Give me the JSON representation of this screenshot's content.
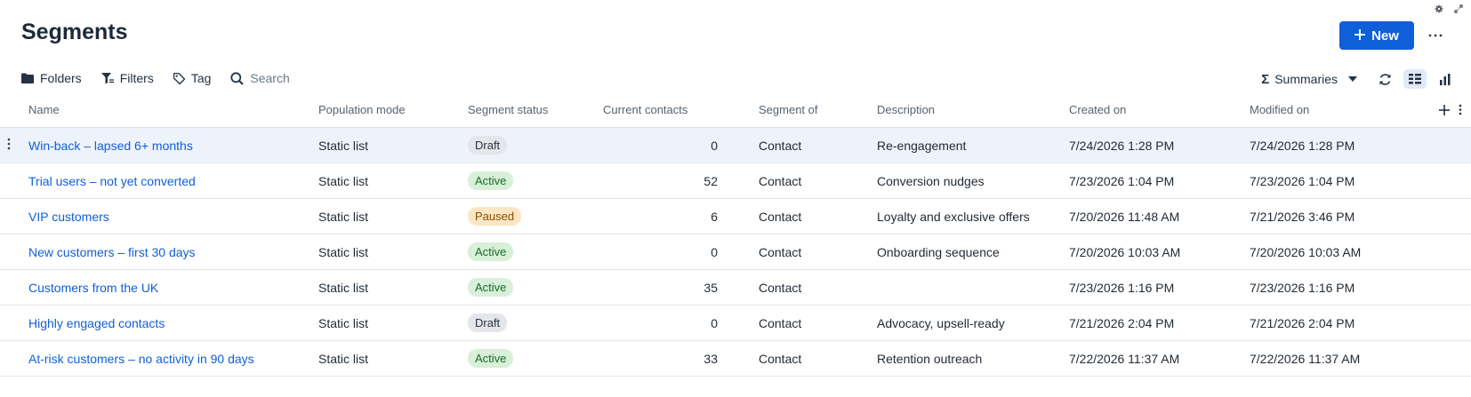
{
  "page": {
    "title": "Segments",
    "new_button_label": "New",
    "more_label": "···"
  },
  "toolbar": {
    "folders_label": "Folders",
    "filters_label": "Filters",
    "tag_label": "Tag",
    "search_placeholder": "Search",
    "summaries_label": "Summaries"
  },
  "table": {
    "headers": {
      "name": "Name",
      "population_mode": "Population mode",
      "segment_status": "Segment status",
      "current_contacts": "Current contacts",
      "segment_of": "Segment of",
      "description": "Description",
      "created_on": "Created on",
      "modified_on": "Modified on"
    },
    "rows": [
      {
        "name": "Win-back – lapsed 6+ months",
        "population_mode": "Static list",
        "status": "Draft",
        "contacts": "0",
        "segment_of": "Contact",
        "description": "Re-engagement",
        "created_on": "7/24/2026 1:28 PM",
        "modified_on": "7/24/2026 1:28 PM"
      },
      {
        "name": "Trial users – not yet converted",
        "population_mode": "Static list",
        "status": "Active",
        "contacts": "52",
        "segment_of": "Contact",
        "description": "Conversion nudges",
        "created_on": "7/23/2026 1:04 PM",
        "modified_on": "7/23/2026 1:04 PM"
      },
      {
        "name": "VIP customers",
        "population_mode": "Static list",
        "status": "Paused",
        "contacts": "6",
        "segment_of": "Contact",
        "description": "Loyalty and exclusive offers",
        "created_on": "7/20/2026 11:48 AM",
        "modified_on": "7/21/2026 3:46 PM"
      },
      {
        "name": "New customers – first 30 days",
        "population_mode": "Static list",
        "status": "Active",
        "contacts": "0",
        "segment_of": "Contact",
        "description": "Onboarding sequence",
        "created_on": "7/20/2026 10:03 AM",
        "modified_on": "7/20/2026 10:03 AM"
      },
      {
        "name": "Customers from the UK",
        "population_mode": "Static list",
        "status": "Active",
        "contacts": "35",
        "segment_of": "Contact",
        "description": "",
        "created_on": "7/23/2026 1:16 PM",
        "modified_on": "7/23/2026 1:16 PM"
      },
      {
        "name": "Highly engaged contacts",
        "population_mode": "Static list",
        "status": "Draft",
        "contacts": "0",
        "segment_of": "Contact",
        "description": "Advocacy, upsell-ready",
        "created_on": "7/21/2026 2:04 PM",
        "modified_on": "7/21/2026 2:04 PM"
      },
      {
        "name": "At-risk customers – no activity in 90 days",
        "population_mode": "Static list",
        "status": "Active",
        "contacts": "33",
        "segment_of": "Contact",
        "description": "Retention outreach",
        "created_on": "7/22/2026 11:37 AM",
        "modified_on": "7/22/2026 11:37 AM"
      }
    ]
  },
  "colors": {
    "accent": "#0f5fd9",
    "draft_badge": "#e4e6e9",
    "active_badge": "#d7f0d7",
    "paused_badge": "#fbe6c3",
    "selected_row": "#eef3fb"
  },
  "icons": {
    "settings": "gear-icon",
    "expand": "expand-icon",
    "new": "plus-icon",
    "folders": "folder-icon",
    "filters": "filter-icon",
    "tag": "tag-icon",
    "search": "search-icon",
    "summaries": "sigma-icon",
    "refresh": "refresh-icon",
    "grid_view": "list-view-icon",
    "chart_view": "bar-chart-icon",
    "add_column": "plus-icon",
    "column_menu": "kebab-icon"
  }
}
